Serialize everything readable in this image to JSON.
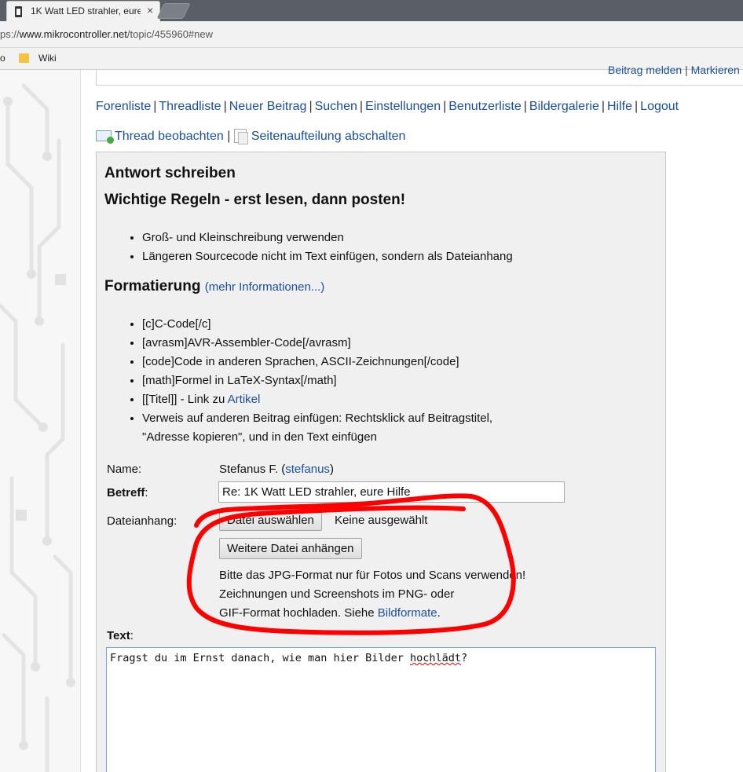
{
  "browser": {
    "tab_title": "1K Watt LED strahler, eure",
    "tab_close": "×",
    "url_prefix": "ps://",
    "url_host": "www.mikrocontroller.net",
    "url_path": "/topic/455960#new",
    "bookmark_fragment": "o",
    "bookmark_wiki": "Wiki"
  },
  "topstrip": {
    "report": "Beitrag melden",
    "sep": "|",
    "mark": "Markieren"
  },
  "nav": {
    "items": [
      "Forenliste",
      "Threadliste",
      "Neuer Beitrag",
      "Suchen",
      "Einstellungen",
      "Benutzerliste",
      "Bildergalerie",
      "Hilfe",
      "Logout"
    ],
    "separator": "|"
  },
  "watch": {
    "observe": "Thread beobachten",
    "sep": "|",
    "paging": "Seitenaufteilung abschalten"
  },
  "form": {
    "heading": "Antwort schreiben",
    "rules_heading": "Wichtige Regeln - erst lesen, dann posten!",
    "rules": [
      "Groß- und Kleinschreibung verwenden",
      "Längeren Sourcecode nicht im Text einfügen, sondern als Dateianhang"
    ],
    "format_heading": "Formatierung",
    "format_more": "(mehr Informationen...)",
    "format_items": {
      "c": "[c]C-Code[/c]",
      "avrasm": "[avrasm]AVR-Assembler-Code[/avrasm]",
      "code": "[code]Code in anderen Sprachen, ASCII-Zeichnungen[/code]",
      "math": "[math]Formel in LaTeX-Syntax[/math]",
      "title_prefix": "[[Titel]] - Link zu ",
      "title_link": "Artikel",
      "ref_line1": "Verweis auf anderen Beitrag einfügen: Rechtsklick auf Beitragstitel,",
      "ref_line2": "\"Adresse kopieren\", und in den Text einfügen"
    },
    "name_label": "Name:",
    "name_value": "Stefanus F.",
    "name_user": "stefanus",
    "subject_label": "Betreff",
    "subject_colon": ":",
    "subject_value": "Re: 1K Watt LED strahler, eure Hilfe",
    "attach_label": "Dateianhang:",
    "choose_file": "Datei auswählen",
    "no_file": "Keine ausgewählt",
    "more_files": "Weitere Datei anhängen",
    "hint_line1": "Bitte das JPG-Format nur für Fotos und Scans verwenden!",
    "hint_line2": "Zeichnungen und Screenshots im PNG- oder",
    "hint_line3_prefix": "GIF-Format hochladen. Siehe ",
    "hint_link": "Bildformate",
    "hint_end": ".",
    "text_label": "Text",
    "text_colon": ":",
    "text_before": "Fragst du im Ernst danach, wie man hier Bilder ",
    "text_misspelled": "hochlädt",
    "text_after": "?"
  },
  "colors": {
    "link": "#1a4fa0",
    "annotation": "#ff0000",
    "formbox": "#f0f0f0"
  }
}
